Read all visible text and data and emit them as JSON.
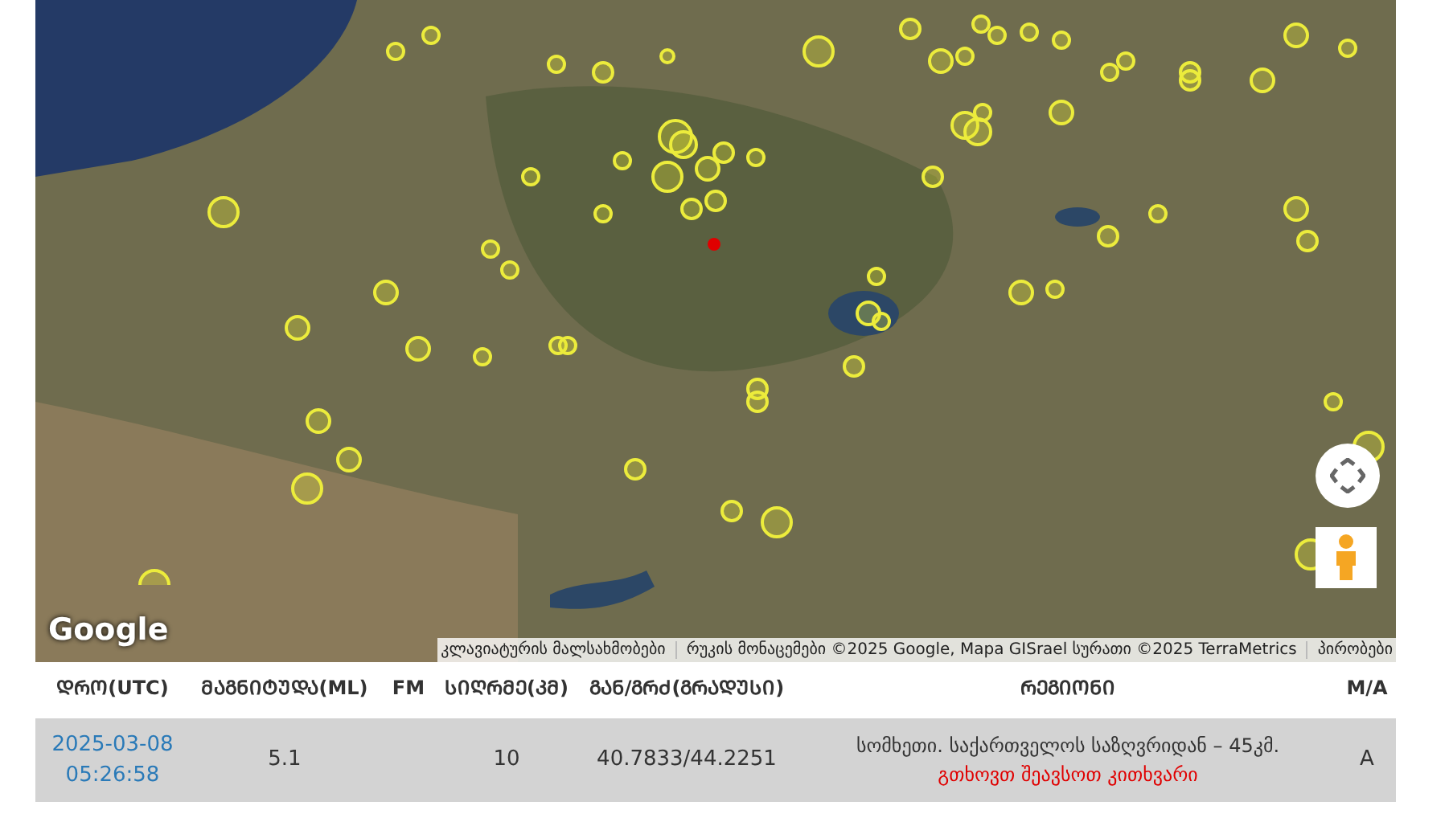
{
  "map": {
    "logo": "Google",
    "attribution": [
      "კლავიატურის მალსახმობები",
      "რუკის მონაცემები ©2025 Google, Mapa GISrael სურათი ©2025 TerraMetrics",
      "პირობები"
    ]
  },
  "table": {
    "columns": [
      "ᲓᲠᲝ(UTC)",
      "ᲛᲐᲒᲜᲘᲢᲣᲓᲐ(ML)",
      "FM",
      "ᲡᲘᲦᲠᲛᲔ(ᲙᲛ)",
      "ᲒᲐᲜ/ᲒᲠᲫ(ᲒᲠᲐᲓᲣᲡᲘ)",
      "ᲠᲔᲒᲘᲝᲜᲘ",
      "M/A"
    ],
    "rows": [
      {
        "date": "2025-03-08",
        "time": "05:26:58",
        "magnitude": "5.1",
        "depth": "10",
        "coordinates": "40.7833/44.2251",
        "region": "სომხეთი. საქართველოს საზღვრიდან – 45კმ.",
        "request": "გთხოვთ შეავსოთ კითხვარი",
        "type": "A"
      }
    ]
  }
}
